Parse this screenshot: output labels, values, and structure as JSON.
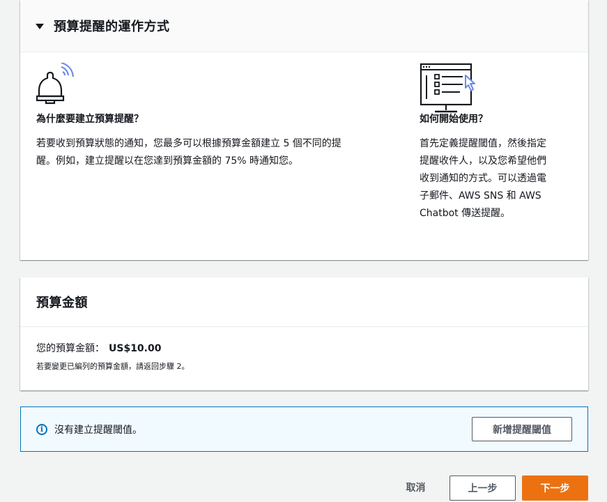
{
  "how_it_works": {
    "title": "預算提醒的運作方式",
    "why": {
      "heading": "為什麼要建立預算提醒？",
      "line1": "若要收到預算狀態的通知，您最多可以根據預算金額建立 5 個不同的提",
      "line2": "醒。例如，建立提醒以在您達到預算金額的 75% 時通知您。"
    },
    "how": {
      "heading": "如何開始使用？",
      "lines": [
        "首先定義提醒閾值，然後指定",
        "提醒收件人，以及您希望他們",
        "收到通知的方式。可以透過電",
        "子郵件、AWS SNS 和 AWS",
        "Chatbot 傳送提醒。"
      ]
    }
  },
  "budget": {
    "title": "預算金額",
    "amount_label": "您的預算金額：",
    "amount_value": "US$10.00",
    "note": "若要變更已編列的預算金額，請返回步驟 2。"
  },
  "info": {
    "text": "沒有建立提醒閾值。",
    "add_button": "新增提醒閾值"
  },
  "footer": {
    "cancel": "取消",
    "previous": "上一步",
    "next": "下一步"
  },
  "colors": {
    "accent_orange": "#ec7211",
    "info_blue": "#0073bb",
    "icon_blue": "#6b8be6"
  }
}
